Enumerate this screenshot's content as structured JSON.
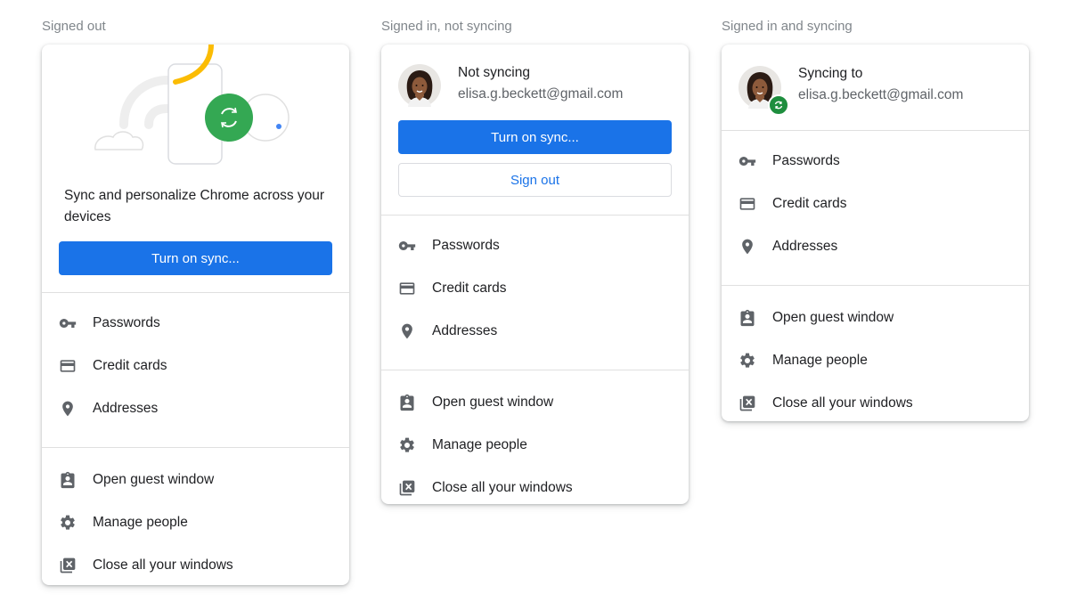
{
  "columns": [
    {
      "label": "Signed out",
      "promo_text": "Sync and personalize Chrome across your devices",
      "sync_button": "Turn on sync...",
      "autofill": [
        "Passwords",
        "Credit cards",
        "Addresses"
      ],
      "actions": [
        "Open guest window",
        "Manage people",
        "Close all your windows"
      ]
    },
    {
      "label": "Signed in, not syncing",
      "status": "Not syncing",
      "email": "elisa.g.beckett@gmail.com",
      "sync_button": "Turn on sync...",
      "signout_button": "Sign out",
      "autofill": [
        "Passwords",
        "Credit cards",
        "Addresses"
      ],
      "actions": [
        "Open guest window",
        "Manage people",
        "Close all your windows"
      ]
    },
    {
      "label": "Signed in and syncing",
      "status": "Syncing to",
      "email": "elisa.g.beckett@gmail.com",
      "autofill": [
        "Passwords",
        "Credit cards",
        "Addresses"
      ],
      "actions": [
        "Open guest window",
        "Manage people",
        "Close all your windows"
      ]
    }
  ],
  "colors": {
    "accent": "#1a73e8",
    "sync_green": "#1e8e3e",
    "illustration_yellow": "#fbbc04",
    "icon_grey": "#5f6368"
  }
}
